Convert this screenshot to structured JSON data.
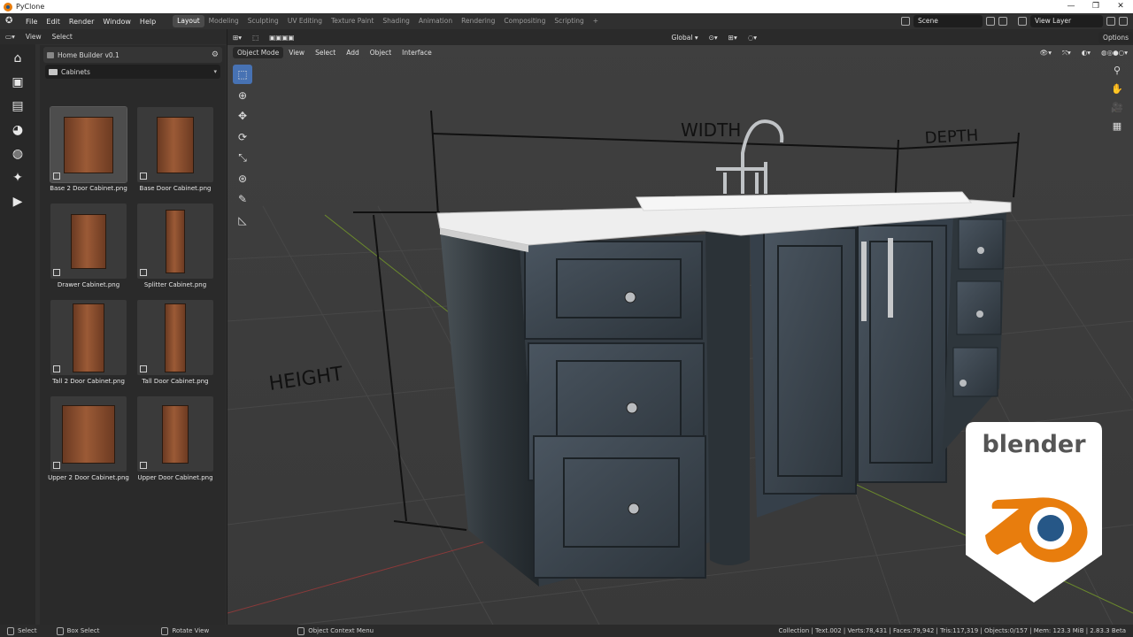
{
  "window": {
    "title": "PyClone",
    "controls": [
      "—",
      "❐",
      "✕"
    ]
  },
  "topbar": {
    "menu": [
      "File",
      "Edit",
      "Render",
      "Window",
      "Help"
    ],
    "tabs": [
      "Layout",
      "Modeling",
      "Sculpting",
      "UV Editing",
      "Texture Paint",
      "Shading",
      "Animation",
      "Rendering",
      "Compositing",
      "Scripting",
      "+"
    ],
    "active_tab": "Layout",
    "scene": "Scene",
    "view_layer": "View Layer"
  },
  "left_header": {
    "items": [
      "View",
      "Select"
    ]
  },
  "asset_browser": {
    "title": "Home Builder v0.1",
    "category": "Cabinets",
    "assets": [
      {
        "label": "Base 2 Door Cabinet.png",
        "selected": true
      },
      {
        "label": "Base Door Cabinet.png",
        "selected": false
      },
      {
        "label": "Drawer Cabinet.png",
        "selected": false
      },
      {
        "label": "Splitter Cabinet.png",
        "selected": false
      },
      {
        "label": "Tall 2 Door Cabinet.png",
        "selected": false
      },
      {
        "label": "Tall Door Cabinet.png",
        "selected": false
      },
      {
        "label": "Upper 2 Door Cabinet.png",
        "selected": false
      },
      {
        "label": "Upper Door Cabinet.png",
        "selected": false
      }
    ]
  },
  "viewport": {
    "header": {
      "orientation": "Global",
      "options": "Options"
    },
    "header2": {
      "mode": "Object Mode",
      "menus": [
        "View",
        "Select",
        "Add",
        "Object",
        "Interface"
      ]
    },
    "scene_text": {
      "width": "WIDTH",
      "depth": "DEPTH",
      "height": "HEIGHT"
    }
  },
  "badge": {
    "text": "blender",
    "colors": {
      "orange": "#e87d0d",
      "blue": "#265787"
    }
  },
  "statusbar": {
    "hints": [
      "Select",
      "Box Select",
      "Rotate View",
      "Object Context Menu"
    ],
    "stats": "Collection | Text.002 | Verts:78,431 | Faces:79,942 | Tris:117,319 | Objects:0/157 | Mem: 123.3 MiB | 2.83.3 Beta"
  }
}
